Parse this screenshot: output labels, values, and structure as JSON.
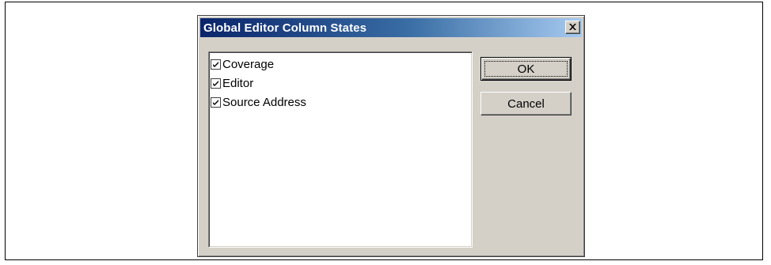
{
  "dialog": {
    "title": "Global Editor Column States",
    "close_icon": "close-x-icon",
    "items": [
      {
        "label": "Coverage",
        "checked": true
      },
      {
        "label": "Editor",
        "checked": true
      },
      {
        "label": "Source Address",
        "checked": true
      }
    ],
    "ok_label": "OK",
    "cancel_label": "Cancel"
  },
  "colors": {
    "title_start": "#0a246a",
    "title_end": "#a6caf0",
    "face": "#d4d0c8"
  }
}
